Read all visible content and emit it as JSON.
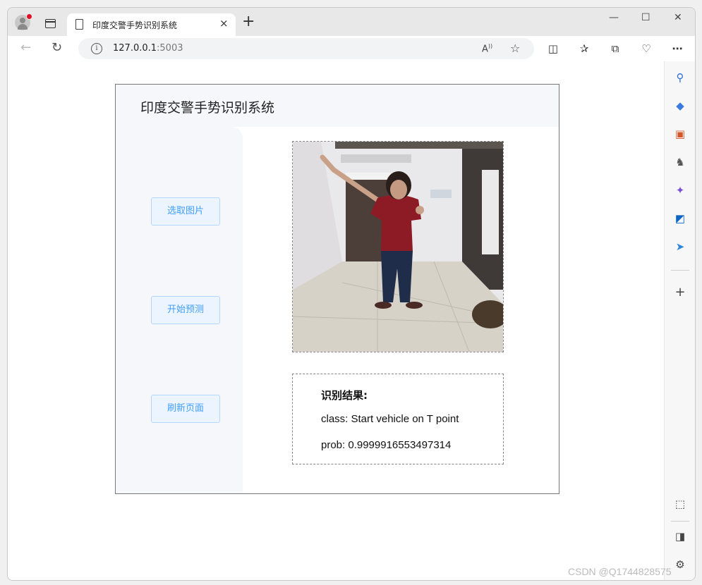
{
  "browser": {
    "tab_title": "印度交警手势识别系统",
    "tab_close": "×",
    "new_tab": "+",
    "minimize": "—",
    "maximize": "☐",
    "close": "✕",
    "url_host": "127.0.0.1",
    "url_port": ":5003",
    "info_glyph": "i"
  },
  "page": {
    "title": "印度交警手势识别系统",
    "buttons": {
      "select_image": "选取图片",
      "start_predict": "开始预测",
      "refresh_page": "刷新页面"
    },
    "result": {
      "heading": "识别结果:",
      "class_line": "class: Start vehicle on T point",
      "prob_line": "prob: 0.9999916553497314"
    }
  },
  "colors": {
    "button_text": "#409eff",
    "button_bg": "#ecf5ff",
    "panel_bg": "#f5f7fa"
  },
  "watermark": "CSDN @Q1744828575"
}
